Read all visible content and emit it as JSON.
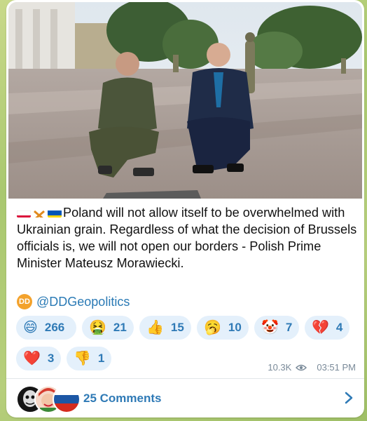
{
  "post": {
    "text": "Poland will not allow itself to be overwhelmed with Ukrainian grain. Regardless of what the decision of Brussels officials is, we will not open our borders - Polish Prime Minister Mateusz Morawiecki.",
    "signature_handle": "@DDGeopolitics",
    "badge_letters": "DD"
  },
  "reactions": [
    {
      "emoji": "😄",
      "count": "266"
    },
    {
      "emoji": "🤮",
      "count": "21"
    },
    {
      "emoji": "👍",
      "count": "15"
    },
    {
      "emoji": "🥱",
      "count": "10"
    },
    {
      "emoji": "🤡",
      "count": "7"
    },
    {
      "emoji": "💔",
      "count": "4"
    },
    {
      "emoji": "❤️",
      "count": "3"
    },
    {
      "emoji": "👎",
      "count": "1"
    }
  ],
  "meta": {
    "views": "10.3K",
    "time": "03:51 PM"
  },
  "comments": {
    "label": "25 Comments"
  },
  "colors": {
    "accent": "#2f7ab6",
    "reaction_bg": "#e4f0fb",
    "badge": "#f3a22c"
  }
}
